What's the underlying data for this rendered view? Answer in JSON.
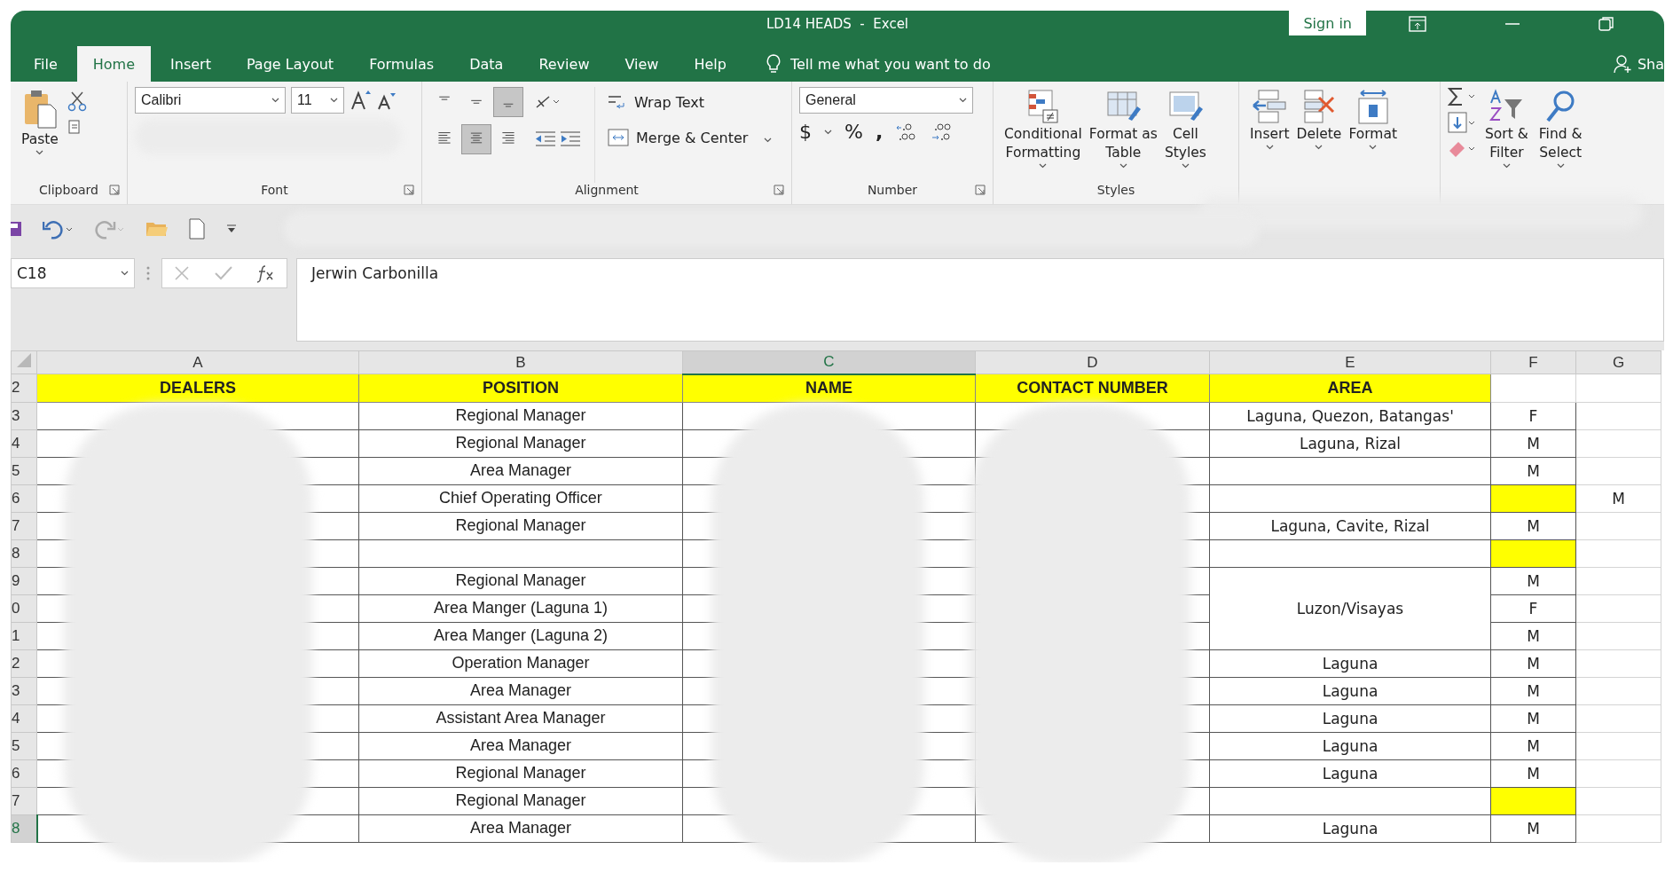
{
  "window": {
    "title": "LD14 HEADS  -  Excel",
    "sign_in": "Sign in"
  },
  "ribbon_tabs": [
    {
      "label": "File",
      "selected": false
    },
    {
      "label": "Home",
      "selected": true
    },
    {
      "label": "Insert",
      "selected": false
    },
    {
      "label": "Page Layout",
      "selected": false
    },
    {
      "label": "Formulas",
      "selected": false
    },
    {
      "label": "Data",
      "selected": false
    },
    {
      "label": "Review",
      "selected": false
    },
    {
      "label": "View",
      "selected": false
    },
    {
      "label": "Help",
      "selected": false
    }
  ],
  "tell_me": "Tell me what you want to do",
  "share": "Sha",
  "clipboard": {
    "paste": "Paste",
    "label": "Clipboard"
  },
  "font": {
    "name": "Calibri",
    "size": "11",
    "label": "Font"
  },
  "alignment": {
    "vertical": [
      {
        "kind": "top",
        "selected": false
      },
      {
        "kind": "middle",
        "selected": false
      },
      {
        "kind": "bottom",
        "selected": true
      }
    ],
    "horizontal": [
      {
        "kind": "left",
        "selected": false
      },
      {
        "kind": "center",
        "selected": true
      },
      {
        "kind": "right",
        "selected": false
      }
    ],
    "wrap_text": "Wrap Text",
    "merge_center": "Merge & Center",
    "label": "Alignment"
  },
  "number": {
    "format": "General",
    "currency": "$",
    "percent": "%",
    "comma": ",",
    "label": "Number"
  },
  "styles": {
    "buttons": [
      {
        "kind": "conditional",
        "lines": [
          "Conditional",
          "Formatting"
        ]
      },
      {
        "kind": "table",
        "lines": [
          "Format as",
          "Table"
        ]
      },
      {
        "kind": "cell",
        "lines": [
          "Cell",
          "Styles"
        ]
      }
    ],
    "label": "Styles"
  },
  "cells": {
    "buttons": [
      {
        "kind": "insert",
        "lines": [
          "Insert"
        ]
      },
      {
        "kind": "delete",
        "lines": [
          "Delete"
        ]
      },
      {
        "kind": "format",
        "lines": [
          "Format"
        ]
      }
    ]
  },
  "editing": {
    "buttons": [
      {
        "kind": "sort",
        "lines": [
          "Sort &",
          "Filter"
        ]
      },
      {
        "kind": "find",
        "lines": [
          "Find &",
          "Select"
        ]
      }
    ]
  },
  "formula_bar": {
    "name_box": "C18",
    "content": "Jerwin Carbonilla"
  },
  "sheet": {
    "columns": [
      {
        "label": "A",
        "selected": false
      },
      {
        "label": "B",
        "selected": false
      },
      {
        "label": "C",
        "selected": true
      },
      {
        "label": "D",
        "selected": false
      },
      {
        "label": "E",
        "selected": false
      },
      {
        "label": "F",
        "selected": false
      },
      {
        "label": "G",
        "selected": false
      }
    ],
    "header_row": {
      "row_number": "2",
      "cells": [
        "DEALERS",
        "POSITION",
        "NAME",
        "CONTACT NUMBER",
        "AREA"
      ]
    },
    "rows": [
      {
        "row_number": "3",
        "selected": false,
        "position": "Regional Manager",
        "area": "Laguna, Quezon, Batangas'",
        "area_merged_with_above": false,
        "column_f": "F",
        "f_highlight": false
      },
      {
        "row_number": "4",
        "selected": false,
        "position": "Regional Manager",
        "area": "Laguna, Rizal",
        "area_merged_with_above": false,
        "column_f": "M",
        "f_highlight": false
      },
      {
        "row_number": "5",
        "selected": false,
        "position": "Area Manager",
        "area_merged_with_above": false,
        "column_f": "M",
        "f_highlight": false
      },
      {
        "row_number": "6",
        "selected": false,
        "position": "Chief Operating Officer",
        "area_merged_with_above": false,
        "f_highlight": true,
        "column_g": "M"
      },
      {
        "row_number": "7",
        "selected": false,
        "position": "Regional Manager",
        "area": "Laguna, Cavite, Rizal",
        "area_merged_with_above": false,
        "column_f": "M",
        "f_highlight": false
      },
      {
        "row_number": "8",
        "selected": false,
        "area_merged_with_above": false,
        "f_highlight": true
      },
      {
        "row_number": "9",
        "selected": false,
        "position": "Regional Manager",
        "area_merged_with_above": false,
        "column_f": "M",
        "f_highlight": false
      },
      {
        "row_number": "0",
        "selected": false,
        "position": "Area Manger (Laguna 1)",
        "area": "Luzon/Visayas",
        "area_merged_with_above": true,
        "column_f": "F",
        "f_highlight": false
      },
      {
        "row_number": "1",
        "selected": false,
        "position": "Area Manger (Laguna 2)",
        "area_merged_with_above": true,
        "column_f": "M",
        "f_highlight": false
      },
      {
        "row_number": "2",
        "selected": false,
        "position": "Operation Manager",
        "area": "Laguna",
        "area_merged_with_above": false,
        "column_f": "M",
        "f_highlight": false
      },
      {
        "row_number": "3",
        "selected": false,
        "position": "Area Manager",
        "area": "Laguna",
        "area_merged_with_above": false,
        "column_f": "M",
        "f_highlight": false
      },
      {
        "row_number": "4",
        "selected": false,
        "position": "Assistant Area Manager",
        "area": "Laguna",
        "area_merged_with_above": false,
        "column_f": "M",
        "f_highlight": false
      },
      {
        "row_number": "5",
        "selected": false,
        "position": "Area Manager",
        "area": "Laguna",
        "area_merged_with_above": false,
        "column_f": "M",
        "f_highlight": false
      },
      {
        "row_number": "6",
        "selected": false,
        "position": "Regional Manager",
        "area": "Laguna",
        "area_merged_with_above": false,
        "column_f": "M",
        "f_highlight": false
      },
      {
        "row_number": "7",
        "selected": false,
        "position": "Regional Manager",
        "area_merged_with_above": false,
        "f_highlight": true
      },
      {
        "row_number": "8",
        "selected": true,
        "position": "Area Manager",
        "area": "Laguna",
        "area_merged_with_above": false,
        "column_f": "M",
        "f_highlight": false
      }
    ]
  }
}
